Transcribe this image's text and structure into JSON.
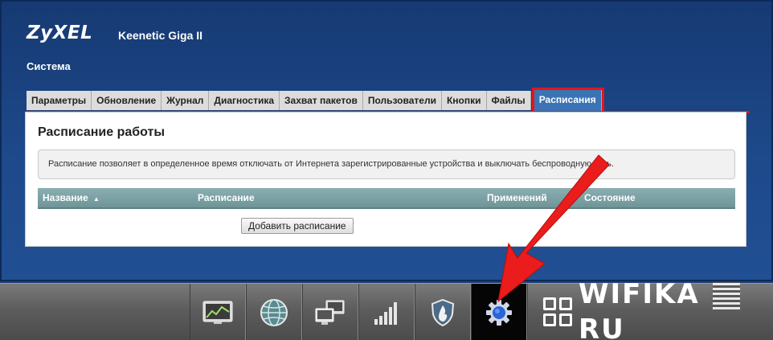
{
  "header": {
    "logo": "ZyXEL",
    "model": "Keenetic Giga II",
    "section_title": "Система"
  },
  "tabs": [
    {
      "label": "Параметры"
    },
    {
      "label": "Обновление"
    },
    {
      "label": "Журнал"
    },
    {
      "label": "Диагностика"
    },
    {
      "label": "Захват пакетов"
    },
    {
      "label": "Пользователи"
    },
    {
      "label": "Кнопки"
    },
    {
      "label": "Файлы"
    },
    {
      "label": "Расписания",
      "active": true
    }
  ],
  "panel": {
    "heading": "Расписание работы",
    "info": "Расписание позволяет в определенное время отключать от Интернета зарегистрированные устройства и выключать беспроводную сеть.",
    "columns": {
      "name": "Название",
      "sort_indicator": "▲",
      "schedule": "Расписание",
      "applied": "Применений",
      "state": "Состояние"
    },
    "add_button": "Добавить расписание"
  },
  "bottom_nav": [
    {
      "icon": "monitor-graph-icon"
    },
    {
      "icon": "globe-icon"
    },
    {
      "icon": "computers-icon"
    },
    {
      "icon": "signal-bars-icon"
    },
    {
      "icon": "shield-icon"
    },
    {
      "icon": "gear-icon",
      "active": true
    }
  ],
  "watermark": {
    "text_left": "WIFIKA",
    "text_right": "RU"
  },
  "colors": {
    "background_blue": "#1e4a8c",
    "tab_active": "#3a74b6",
    "highlight_red": "#e3161b",
    "table_header": "#7fa3a6"
  }
}
